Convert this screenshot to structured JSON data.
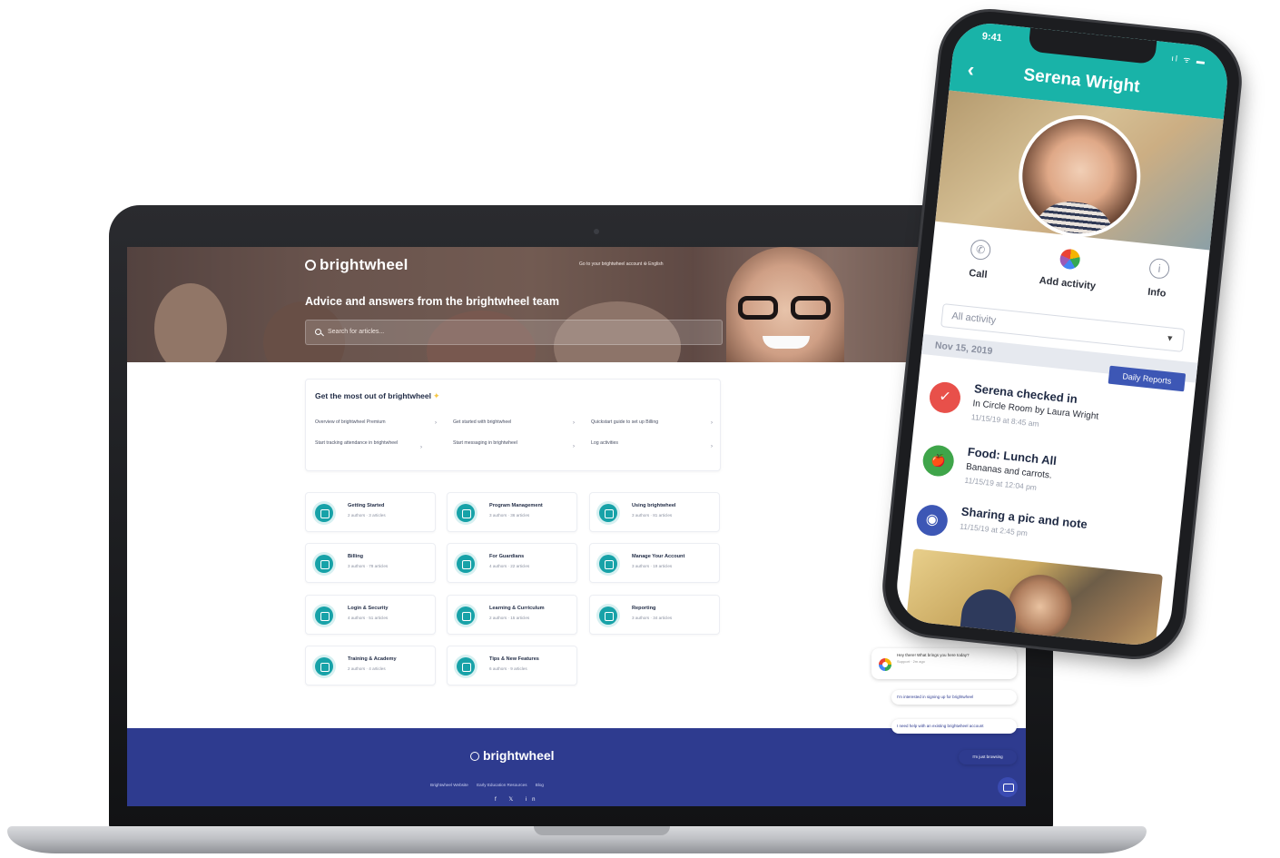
{
  "laptop": {
    "brand": "brightwheel",
    "hero": {
      "top_links": "Go to your brightwheel account   ⊕ English",
      "title": "Advice and answers from the brightwheel team",
      "search_placeholder": "Search for articles..."
    },
    "most": {
      "title": "Get the most out of brightwheel",
      "links": [
        "Overview of brightwheel Premium",
        "Get started with brightwheel",
        "Quickstart guide to set up Billing",
        "Start tracking attendance in brightwheel",
        "Start messaging in brightwheel",
        "Log activities"
      ]
    },
    "categories": [
      {
        "name": "Getting Started",
        "meta": "2 authors · 3 articles"
      },
      {
        "name": "Program Management",
        "meta": "3 authors · 36 articles"
      },
      {
        "name": "Using brightwheel",
        "meta": "3 authors · 81 articles"
      },
      {
        "name": "Billing",
        "meta": "3 authors · 78 articles"
      },
      {
        "name": "For Guardians",
        "meta": "4 authors · 22 articles"
      },
      {
        "name": "Manage Your Account",
        "meta": "3 authors · 19 articles"
      },
      {
        "name": "Login & Security",
        "meta": "4 authors · 51 articles"
      },
      {
        "name": "Learning & Curriculum",
        "meta": "2 authors · 15 articles"
      },
      {
        "name": "Reporting",
        "meta": "3 authors · 34 articles"
      },
      {
        "name": "Training & Academy",
        "meta": "2 authors · 4 articles"
      },
      {
        "name": "Tips & New Features",
        "meta": "6 authors · 9 articles"
      }
    ],
    "footer": {
      "brand": "brightwheel",
      "links": [
        "Brightwheel Website",
        "Early Education Resources",
        "Blog"
      ],
      "social": "f  𝕏  in"
    },
    "chat": {
      "greeting": "Hey there! What brings you here today?",
      "greeting_meta": "Support · 2m ago",
      "options": [
        "I'm interested in signing up for brightwheel",
        "I need help with an existing brightwheel account",
        "I'm just browsing"
      ]
    }
  },
  "phone": {
    "time": "9:41",
    "status_icons": "ıl ᯤ ▬",
    "back_icon": "‹",
    "name": "Serena Wright",
    "actions": [
      {
        "icon": "✆",
        "label": "Call"
      },
      {
        "icon": "",
        "label": "Add activity"
      },
      {
        "icon": "i",
        "label": "Info"
      }
    ],
    "filter": "All activity",
    "filter_caret": "▼",
    "date": "Nov 15, 2019",
    "daily_reports": "Daily Reports",
    "feed": [
      {
        "icon": "✓",
        "color": "#e8504a",
        "title": "Serena checked in",
        "sub": "In Circle Room by Laura Wright",
        "time": "11/15/19 at 8:45 am"
      },
      {
        "icon": "🍎",
        "color": "#3fa54a",
        "title": "Food: Lunch All",
        "sub": "Bananas and carrots.",
        "time": "11/15/19 at 12:04 pm"
      },
      {
        "icon": "◉",
        "color": "#3d57b5",
        "title": "Sharing a pic and note",
        "sub": "",
        "time": "11/15/19 at 2:45 pm"
      }
    ]
  }
}
